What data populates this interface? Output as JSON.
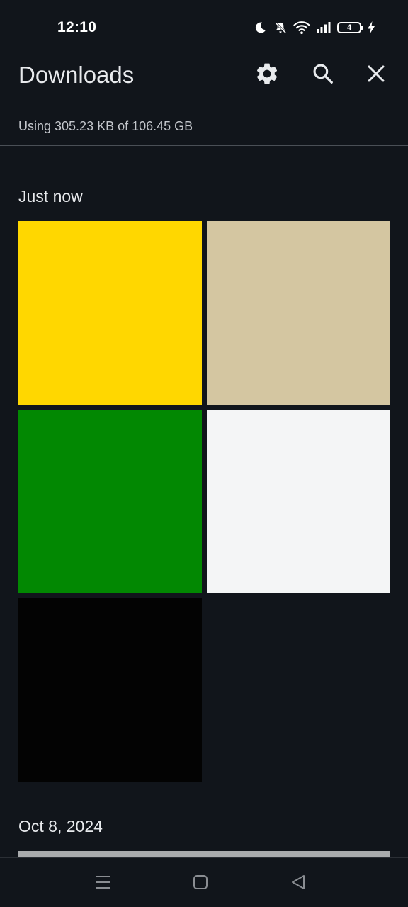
{
  "status_bar": {
    "time": "12:10",
    "icons": [
      "moon-icon",
      "bell-off-icon",
      "wifi-icon",
      "signal-icon",
      "battery-icon",
      "charging-bolt-icon"
    ],
    "battery_level": "4"
  },
  "header": {
    "title": "Downloads",
    "actions": [
      "settings-icon",
      "search-icon",
      "close-icon"
    ]
  },
  "storage": {
    "text": "Using 305.23 KB of 106.45 GB"
  },
  "sections": [
    {
      "label": "Just now",
      "items": [
        {
          "color": "#ffd700"
        },
        {
          "color": "#d4c6a1"
        },
        {
          "color": "#028802"
        },
        {
          "color": "#f4f5f6"
        },
        {
          "color": "#030303"
        }
      ]
    },
    {
      "label": "Oct 8, 2024",
      "items": [
        {
          "color": "#a9abad"
        }
      ]
    }
  ],
  "nav_bar": {
    "buttons": [
      "menu-icon",
      "home-icon",
      "back-icon"
    ]
  },
  "colors": {
    "background": "#11151b",
    "text": "#e8eaed",
    "secondary_text": "#c4c7cc",
    "divider": "#4a4f56"
  }
}
